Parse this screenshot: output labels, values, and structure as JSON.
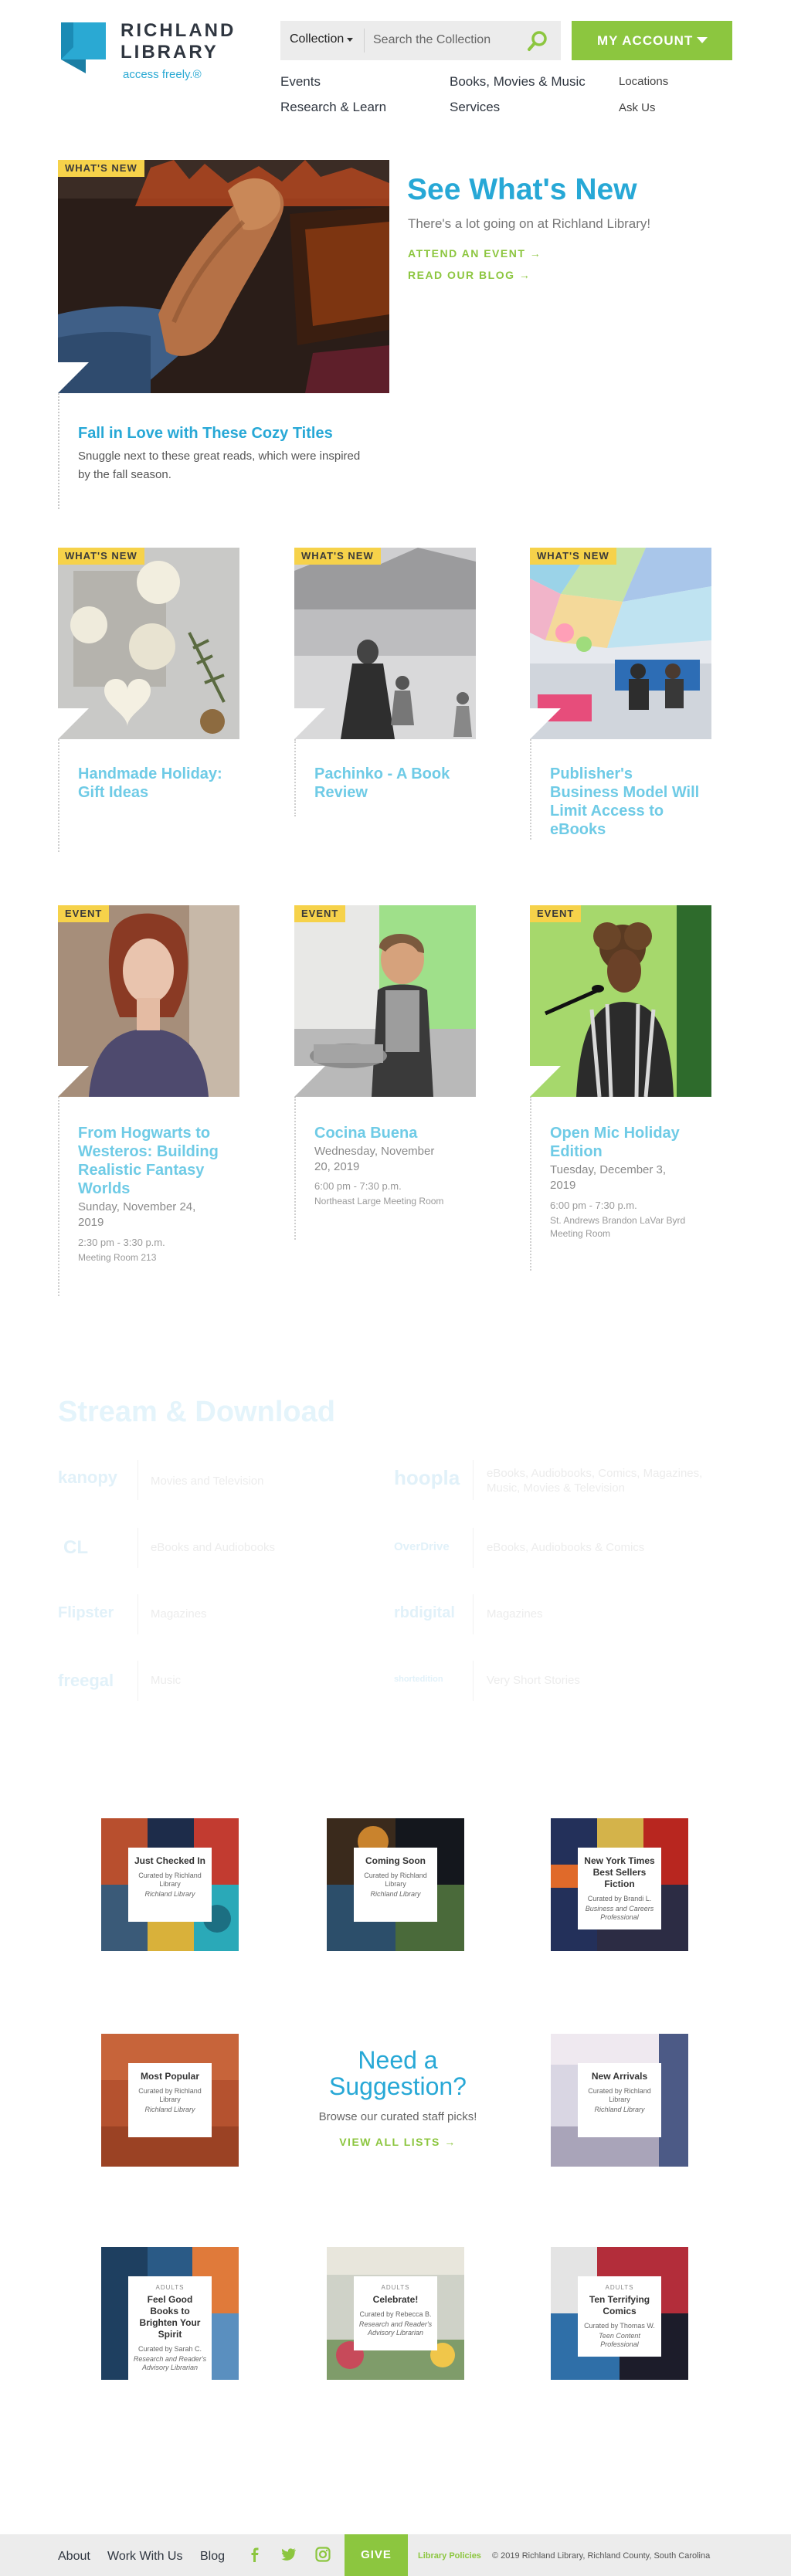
{
  "header": {
    "logo_title_line1": "RICHLAND",
    "logo_title_line2": "LIBRARY",
    "logo_tagline": "access freely.®",
    "search_scope": "Collection",
    "search_placeholder": "Search the Collection",
    "account_label": "MY ACCOUNT",
    "nav": {
      "events": "Events",
      "books": "Books, Movies & Music",
      "locations": "Locations",
      "research": "Research & Learn",
      "services": "Services",
      "ask": "Ask Us"
    },
    "colors": {
      "accent_green": "#8cc63f",
      "brand_blue": "#27a8d6",
      "badge_yellow": "#f6d24a"
    }
  },
  "whats_new": {
    "heading": "See What's New",
    "subtitle": "There's a lot going on at Richland Library!",
    "link_event": "ATTEND AN EVENT →",
    "link_blog": "READ OUR BLOG →",
    "featured": {
      "badge": "WHAT'S NEW",
      "title": "Fall in Love with These Cozy Titles",
      "description": "Snuggle next to these great reads, which were inspired by the fall season."
    }
  },
  "articles": [
    {
      "badge": "WHAT'S NEW",
      "title": "Handmade Holiday: Gift Ideas"
    },
    {
      "badge": "WHAT'S NEW",
      "title": "Pachinko - A Book Review"
    },
    {
      "badge": "WHAT'S NEW",
      "title": "Publisher's Business Model Will Limit Access to eBooks"
    }
  ],
  "events": [
    {
      "badge": "EVENT",
      "title": "From Hogwarts to Westeros: Building Realistic Fantasy Worlds",
      "date": "Sunday, November 24, 2019",
      "time": "2:30 pm - 3:30 p.m.",
      "room": "Meeting Room 213"
    },
    {
      "badge": "EVENT",
      "title": "Cocina Buena",
      "date": "Wednesday, November 20, 2019",
      "time": "6:00 pm - 7:30 p.m.",
      "room": "Northeast Large Meeting Room"
    },
    {
      "badge": "EVENT",
      "title": "Open Mic Holiday Edition",
      "date": "Tuesday, December 3, 2019",
      "time": "6:00 pm - 7:30 p.m.",
      "room": "St. Andrews Brandon LaVar Byrd Meeting Room"
    }
  ],
  "stream": {
    "heading": "Stream & Download",
    "services": [
      {
        "logo": "kanopy",
        "desc": "Movies and Television"
      },
      {
        "logo": "hoopla",
        "desc": "eBooks, Audiobooks, Comics, Magazines, Music, Movies & Television"
      },
      {
        "logo": "CL",
        "desc": "eBooks and Audiobooks"
      },
      {
        "logo": "OverDrive",
        "desc": "eBooks, Audiobooks & Comics"
      },
      {
        "logo": "Flipster",
        "desc": "Magazines"
      },
      {
        "logo": "rbdigital",
        "desc": "Magazines"
      },
      {
        "logo": "freegal",
        "desc": "Music"
      },
      {
        "logo": "shortedition",
        "desc": "Very Short Stories"
      }
    ]
  },
  "lists": [
    {
      "kicker": "",
      "title": "Just Checked In",
      "curator": "Curated by Richland Library",
      "org": "Richland Library"
    },
    {
      "kicker": "",
      "title": "Coming Soon",
      "curator": "Curated by Richland Library",
      "org": "Richland Library"
    },
    {
      "kicker": "",
      "title": "New York Times Best Sellers Fiction",
      "curator": "Curated by Brandi L.",
      "org": "Business and Careers Professional"
    },
    {
      "kicker": "",
      "title": "Most Popular",
      "curator": "Curated by Richland Library",
      "org": "Richland Library"
    },
    {
      "kicker": "",
      "title": "New Arrivals",
      "curator": "Curated by Richland Library",
      "org": "Richland Library"
    },
    {
      "kicker": "ADULTS",
      "title": "Feel Good Books to Brighten Your Spirit",
      "curator": "Curated by Sarah C.",
      "org": "Research and Reader's Advisory Librarian"
    },
    {
      "kicker": "ADULTS",
      "title": "Celebrate!",
      "curator": "Curated by Rebecca B.",
      "org": "Research and Reader's Advisory Librarian"
    },
    {
      "kicker": "ADULTS",
      "title": "Ten Terrifying Comics",
      "curator": "Curated by Thomas W.",
      "org": "Teen Content Professional"
    }
  ],
  "suggestion": {
    "heading": "Need a Suggestion?",
    "subtitle": "Browse our curated staff picks!",
    "link": "VIEW ALL LISTS →"
  },
  "footer": {
    "about": "About",
    "work": "Work With Us",
    "blog": "Blog",
    "give": "GIVE",
    "policies": "Library Policies",
    "copyright": "© 2019 Richland Library, Richland County, South Carolina"
  }
}
